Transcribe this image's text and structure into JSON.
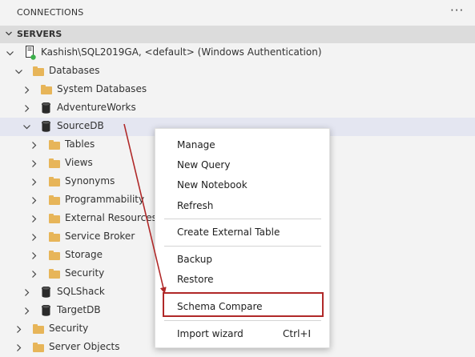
{
  "panel": {
    "title": "CONNECTIONS",
    "more": "···"
  },
  "section": {
    "title": "SERVERS"
  },
  "tree": {
    "server": "Kashish\\SQL2019GA, <default> (Windows Authentication)",
    "databases": "Databases",
    "system_databases": "System Databases",
    "adventureworks": "AdventureWorks",
    "sourcedb": "SourceDB",
    "tables": "Tables",
    "views": "Views",
    "synonyms": "Synonyms",
    "programmability": "Programmability",
    "external_resources": "External Resources",
    "service_broker": "Service Broker",
    "storage": "Storage",
    "db_security": "Security",
    "sqlshack": "SQLShack",
    "targetdb": "TargetDB",
    "security": "Security",
    "server_objects": "Server Objects"
  },
  "context_menu": {
    "manage": "Manage",
    "new_query": "New Query",
    "new_notebook": "New Notebook",
    "refresh": "Refresh",
    "create_external_table": "Create External Table",
    "backup": "Backup",
    "restore": "Restore",
    "schema_compare": "Schema Compare",
    "import_wizard": "Import wizard",
    "import_wizard_shortcut": "Ctrl+I"
  },
  "colors": {
    "folder": "#e7b559",
    "highlight": "#b02828",
    "connected": "#3bb04a",
    "selected_row": "#e4e6f1"
  }
}
